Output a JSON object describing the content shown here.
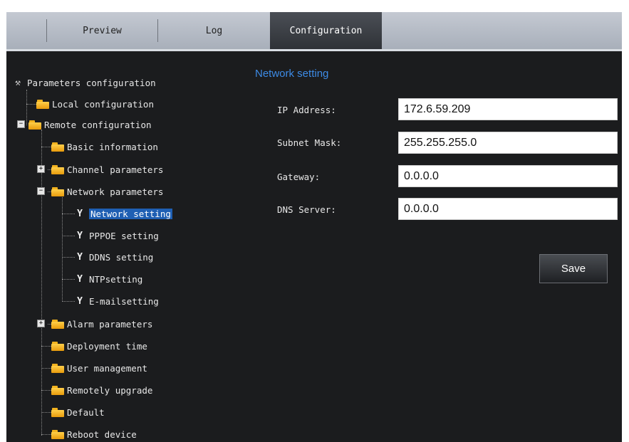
{
  "tabs": [
    {
      "label": "Preview"
    },
    {
      "label": "Log"
    },
    {
      "label": "Configuration",
      "active": true
    }
  ],
  "tree": {
    "root": "Parameters configuration",
    "local": "Local configuration",
    "remote": "Remote configuration",
    "basic": "Basic information",
    "channel": "Channel parameters",
    "network": "Network parameters",
    "network_setting": "Network setting",
    "pppoe": "PPPOE setting",
    "ddns": "DDNS setting",
    "ntp": "NTPsetting",
    "email": "E-mailsetting",
    "alarm": "Alarm parameters",
    "deployment": "Deployment time",
    "user": "User management",
    "upgrade": "Remotely upgrade",
    "default": "Default",
    "reboot": "Reboot device"
  },
  "form": {
    "title": "Network setting",
    "ip_label": "IP Address:",
    "ip_value": "172.6.59.209",
    "mask_label": "Subnet Mask:",
    "mask_value": "255.255.255.0",
    "gateway_label": "Gateway:",
    "gateway_value": "0.0.0.0",
    "dns_label": "DNS Server:",
    "dns_value": "0.0.0.0",
    "save_label": "Save"
  },
  "colors": {
    "panel_bg": "#1b1c1e",
    "section_title": "#3d8be6",
    "selection": "#1f5fb3",
    "folder": "#f5b82a"
  }
}
